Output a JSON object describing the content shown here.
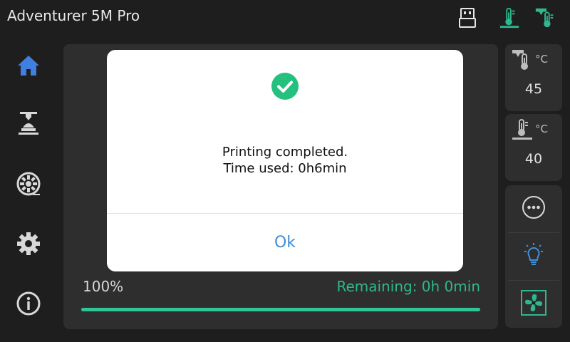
{
  "app": {
    "title": "Adventurer 5M Pro"
  },
  "topbar": {
    "icons": [
      "usb-icon",
      "bed-thermometer-icon",
      "nozzle-thermometer-icon"
    ]
  },
  "sidebar": {
    "items": [
      {
        "icon": "home-icon",
        "active": true
      },
      {
        "icon": "print-icon"
      },
      {
        "icon": "filament-spool-icon"
      },
      {
        "icon": "settings-gear-icon"
      },
      {
        "icon": "info-icon"
      }
    ]
  },
  "status": {
    "progress_text": "100%",
    "progress": 1.0,
    "remaining": "Remaining: 0h 0min"
  },
  "temps": {
    "nozzle": {
      "unit": "°C",
      "value": "45"
    },
    "bed": {
      "unit": "°C",
      "value": "40"
    }
  },
  "controls": [
    "more-options-icon",
    "light-bulb-icon",
    "fan-icon"
  ],
  "dialog": {
    "line1": "Printing completed.",
    "line2": "Time used: 0h6min",
    "ok_label": "Ok"
  },
  "colors": {
    "accent_green": "#2fb78e",
    "accent_blue": "#3f8fd8",
    "background": "#1e1e1e",
    "panel": "#2e2e2e"
  }
}
